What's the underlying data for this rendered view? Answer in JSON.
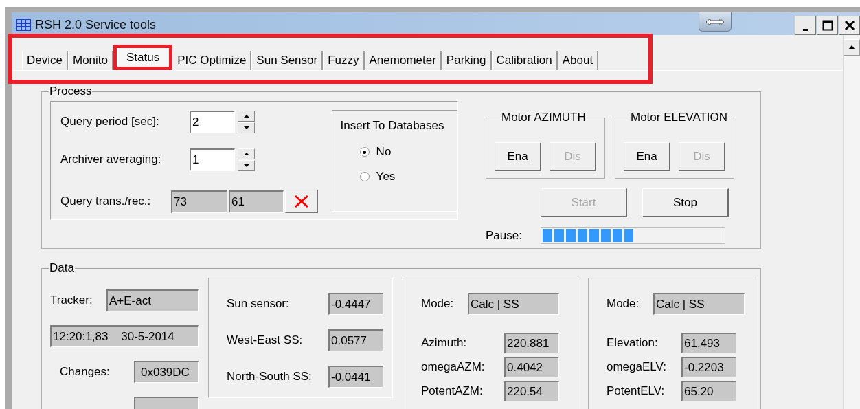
{
  "window": {
    "title": "RSH 2.0 Service tools"
  },
  "tab_bar": {
    "highlighted": true,
    "tabs": [
      {
        "label": "Device",
        "selected": false,
        "highlighted": false
      },
      {
        "label": "Monito",
        "selected": false,
        "highlighted": false
      },
      {
        "label": "Status",
        "selected": true,
        "highlighted": true
      },
      {
        "label": "PIC Optimize",
        "selected": false,
        "highlighted": false
      },
      {
        "label": "Sun Sensor",
        "selected": false,
        "highlighted": false
      },
      {
        "label": "Fuzzy",
        "selected": false,
        "highlighted": false
      },
      {
        "label": "Anemometer",
        "selected": false,
        "highlighted": false
      },
      {
        "label": "Parking",
        "selected": false,
        "highlighted": false
      },
      {
        "label": "Calibration",
        "selected": false,
        "highlighted": false
      },
      {
        "label": "About",
        "selected": false,
        "highlighted": false
      }
    ]
  },
  "process": {
    "title": "Process",
    "spinners": [
      {
        "label": "Query period [sec]:",
        "value": "2"
      },
      {
        "label": "Archiver averaging:",
        "value": "1"
      }
    ],
    "query": {
      "label": "Query trans./rec.:",
      "values": [
        "73",
        "61"
      ]
    },
    "database": {
      "title": "Insert To Databases",
      "options": [
        {
          "label": "No",
          "selected": true
        },
        {
          "label": "Yes",
          "selected": false
        }
      ]
    },
    "motors": [
      {
        "title": "Motor AZIMUTH",
        "buttons": [
          {
            "label": "Ena",
            "disabled": false
          },
          {
            "label": "Dis",
            "disabled": true
          }
        ]
      },
      {
        "title": "Motor ELEVATION",
        "buttons": [
          {
            "label": "Ena",
            "disabled": false
          },
          {
            "label": "Dis",
            "disabled": true
          }
        ]
      }
    ],
    "buttons": [
      {
        "label": "Start",
        "disabled": true
      },
      {
        "label": "Stop",
        "disabled": false
      }
    ],
    "pause": {
      "label": "Pause:",
      "level": 0.5
    }
  },
  "data": {
    "title": "Data",
    "tracker": {
      "label": "Tracker:",
      "value": "A+E-act"
    },
    "timestamp": "12:20:1,83    30-5-2014",
    "changes": {
      "label": "Changes:",
      "value": "0x039DC"
    },
    "sensors": [
      {
        "label": "Sun sensor:",
        "value": "-0.4447"
      },
      {
        "label": "West-East SS:",
        "value": "0.0577"
      },
      {
        "label": "North-South SS:",
        "value": "-0.0441"
      }
    ],
    "axes": [
      {
        "mode_label": "Mode:",
        "mode": "Calc | SS",
        "rows": [
          {
            "label": "Azimuth:",
            "value": "220.881"
          },
          {
            "label": "omegaAZM:",
            "value": "0.4042"
          },
          {
            "label": "PotentAZM:",
            "value": "220.54"
          }
        ]
      },
      {
        "mode_label": "Mode:",
        "mode": "Calc | SS",
        "rows": [
          {
            "label": "Elevation:",
            "value": "61.493"
          },
          {
            "label": "omegaELV:",
            "value": "-0.2203"
          },
          {
            "label": "PotentELV:",
            "value": "65.20"
          }
        ]
      }
    ]
  }
}
